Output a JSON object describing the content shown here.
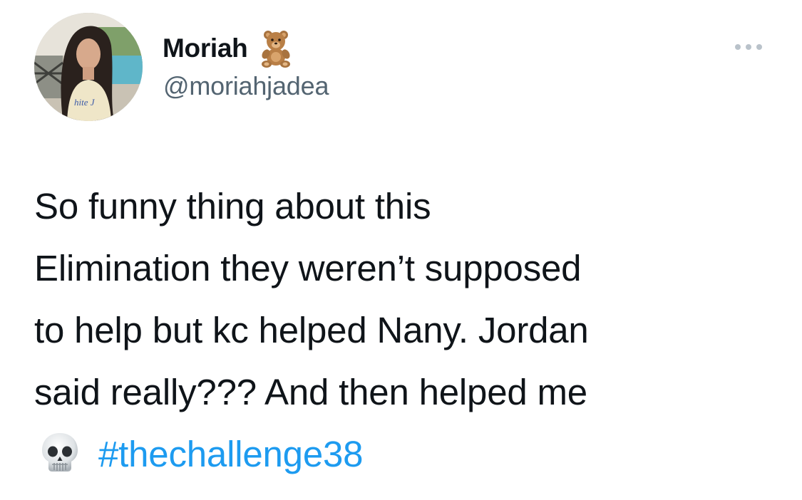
{
  "author": {
    "display_name": "Moriah",
    "name_emoji": "teddy-bear-icon",
    "handle": "@moriahjadea",
    "avatar": "profile-photo"
  },
  "menu": {
    "more_icon": "more-options-icon"
  },
  "tweet": {
    "lines": [
      "So funny thing about this",
      "Elimination they weren’t supposed",
      "to help but kc helped Nany. Jordan",
      "said really??? And then helped me"
    ],
    "trailing_emoji": "skull-icon",
    "hashtag": "#thechallenge38"
  },
  "colors": {
    "text": "#0f1419",
    "secondary_text": "#536471",
    "link": "#1d9bf0",
    "background": "#ffffff"
  }
}
